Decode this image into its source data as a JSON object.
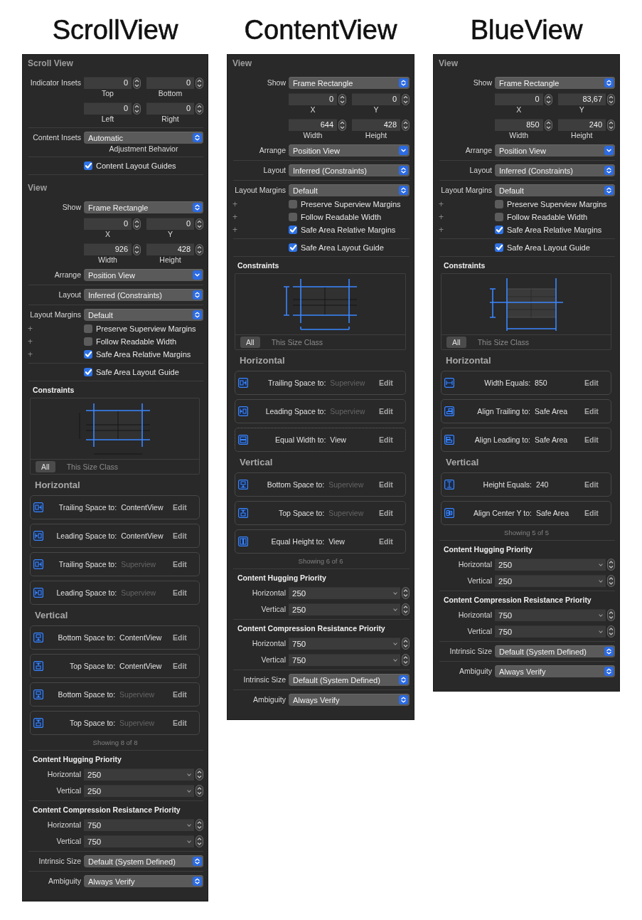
{
  "panels": [
    {
      "heading": "ScrollView",
      "groups": [
        [
          {
            "kind": "section_title",
            "text": "Scroll View"
          },
          {
            "kind": "field_pair",
            "label": "Indicator Insets",
            "fields": [
              {
                "value": "0",
                "caption": "Top"
              },
              {
                "value": "0",
                "caption": "Bottom"
              }
            ]
          },
          {
            "kind": "field_pair",
            "fields": [
              {
                "value": "0",
                "caption": "Left"
              },
              {
                "value": "0",
                "caption": "Right"
              }
            ]
          }
        ],
        [
          {
            "kind": "popup",
            "label": "Content Insets",
            "value": "Automatic",
            "caption": "Adjustment Behavior"
          }
        ],
        [
          {
            "kind": "checkbox",
            "label": "Content Layout Guides",
            "checked": true
          }
        ],
        [
          {
            "kind": "section_title",
            "text": "View"
          },
          {
            "kind": "popup",
            "label": "Show",
            "value": "Frame Rectangle"
          },
          {
            "kind": "field_pair",
            "fields": [
              {
                "value": "0",
                "caption": "X"
              },
              {
                "value": "0",
                "caption": "Y"
              }
            ]
          },
          {
            "kind": "field_pair",
            "fields": [
              {
                "value": "926",
                "caption": "Width"
              },
              {
                "value": "428",
                "caption": "Height"
              }
            ]
          },
          {
            "kind": "pulldown",
            "label": "Arrange",
            "value": "Position View"
          }
        ],
        [
          {
            "kind": "popup",
            "label": "Layout",
            "value": "Inferred (Constraints)"
          }
        ],
        [
          {
            "kind": "popup",
            "label": "Layout Margins",
            "value": "Default"
          },
          {
            "kind": "checkbox",
            "prefix": "+",
            "label": "Preserve Superview Margins",
            "checked": false
          },
          {
            "kind": "checkbox",
            "prefix": "+",
            "label": "Follow Readable Width",
            "checked": false
          },
          {
            "kind": "checkbox",
            "prefix": "+",
            "label": "Safe Area Relative Margins",
            "checked": true
          }
        ],
        [
          {
            "kind": "checkbox",
            "label": "Safe Area Layout Guide",
            "checked": true
          }
        ],
        [
          {
            "kind": "constraints",
            "title": "Constraints",
            "diagram": {
              "kind": "edges"
            },
            "tabs": [
              {
                "label": "All",
                "selected": true
              },
              {
                "label": "This Size Class",
                "selected": false
              }
            ]
          },
          {
            "kind": "constraint_list",
            "heading": "Horizontal",
            "items": [
              {
                "kind": "trailing",
                "label": "Trailing Space to:",
                "target": "ContentView",
                "dimmed": false,
                "dashed": false,
                "action": "Edit"
              },
              {
                "kind": "leading",
                "label": "Leading Space to:",
                "target": "ContentView",
                "dimmed": false,
                "dashed": false,
                "action": "Edit"
              },
              {
                "kind": "trailing",
                "label": "Trailing Space to:",
                "target": "Superview",
                "dimmed": true,
                "dashed": false,
                "action": "Edit"
              },
              {
                "kind": "leading",
                "label": "Leading Space to:",
                "target": "Superview",
                "dimmed": true,
                "dashed": false,
                "action": "Edit"
              }
            ]
          },
          {
            "kind": "constraint_list",
            "heading": "Vertical",
            "items": [
              {
                "kind": "bottom",
                "label": "Bottom Space to:",
                "target": "ContentView",
                "dimmed": false,
                "dashed": false,
                "action": "Edit"
              },
              {
                "kind": "top",
                "label": "Top Space to:",
                "target": "ContentView",
                "dimmed": false,
                "dashed": false,
                "action": "Edit"
              },
              {
                "kind": "bottom",
                "label": "Bottom Space to:",
                "target": "Superview",
                "dimmed": true,
                "dashed": false,
                "action": "Edit"
              },
              {
                "kind": "top",
                "label": "Top Space to:",
                "target": "Superview",
                "dimmed": true,
                "dashed": false,
                "action": "Edit"
              }
            ]
          },
          {
            "kind": "footnote",
            "text": "Showing 8 of 8"
          }
        ],
        [
          {
            "kind": "priority",
            "title": "Content Hugging Priority",
            "rows": [
              {
                "label": "Horizontal",
                "value": "250"
              },
              {
                "label": "Vertical",
                "value": "250"
              }
            ]
          }
        ],
        [
          {
            "kind": "priority",
            "title": "Content Compression Resistance Priority",
            "rows": [
              {
                "label": "Horizontal",
                "value": "750"
              },
              {
                "label": "Vertical",
                "value": "750"
              }
            ]
          }
        ],
        [
          {
            "kind": "popup",
            "label": "Intrinsic Size",
            "value": "Default (System Defined)"
          }
        ],
        [
          {
            "kind": "popup",
            "label": "Ambiguity",
            "value": "Always Verify"
          }
        ]
      ]
    },
    {
      "heading": "ContentView",
      "groups": [
        [
          {
            "kind": "section_title",
            "text": "View"
          },
          {
            "kind": "popup",
            "label": "Show",
            "value": "Frame Rectangle"
          },
          {
            "kind": "field_pair",
            "fields": [
              {
                "value": "0",
                "caption": "X"
              },
              {
                "value": "0",
                "caption": "Y"
              }
            ]
          },
          {
            "kind": "field_pair",
            "fields": [
              {
                "value": "644",
                "caption": "Width"
              },
              {
                "value": "428",
                "caption": "Height"
              }
            ]
          },
          {
            "kind": "pulldown",
            "label": "Arrange",
            "value": "Position View"
          }
        ],
        [
          {
            "kind": "popup",
            "label": "Layout",
            "value": "Inferred (Constraints)"
          }
        ],
        [
          {
            "kind": "popup",
            "label": "Layout Margins",
            "value": "Default"
          },
          {
            "kind": "checkbox",
            "prefix": "+",
            "label": "Preserve Superview Margins",
            "checked": false
          },
          {
            "kind": "checkbox",
            "prefix": "+",
            "label": "Follow Readable Width",
            "checked": false
          },
          {
            "kind": "checkbox",
            "prefix": "+",
            "label": "Safe Area Relative Margins",
            "checked": true
          }
        ],
        [
          {
            "kind": "checkbox",
            "label": "Safe Area Layout Guide",
            "checked": true
          }
        ],
        [
          {
            "kind": "constraints",
            "title": "Constraints",
            "diagram": {
              "kind": "edges_size"
            },
            "tabs": [
              {
                "label": "All",
                "selected": true
              },
              {
                "label": "This Size Class",
                "selected": false
              }
            ]
          },
          {
            "kind": "constraint_list",
            "heading": "Horizontal",
            "items": [
              {
                "kind": "trailing",
                "label": "Trailing Space to:",
                "target": "Superview",
                "dimmed": true,
                "dashed": false,
                "action": "Edit"
              },
              {
                "kind": "leading",
                "label": "Leading Space to:",
                "target": "Superview",
                "dimmed": true,
                "dashed": false,
                "action": "Edit"
              },
              {
                "kind": "equal_width",
                "label": "Equal Width to:",
                "target": "View",
                "dimmed": false,
                "dashed": true,
                "action": "Edit"
              }
            ]
          },
          {
            "kind": "constraint_list",
            "heading": "Vertical",
            "items": [
              {
                "kind": "bottom",
                "label": "Bottom Space to:",
                "target": "Superview",
                "dimmed": true,
                "dashed": false,
                "action": "Edit"
              },
              {
                "kind": "top",
                "label": "Top Space to:",
                "target": "Superview",
                "dimmed": true,
                "dashed": false,
                "action": "Edit"
              },
              {
                "kind": "equal_height",
                "label": "Equal Height to:",
                "target": "View",
                "dimmed": false,
                "dashed": false,
                "action": "Edit"
              }
            ]
          },
          {
            "kind": "footnote",
            "text": "Showing 6 of 6"
          }
        ],
        [
          {
            "kind": "priority",
            "title": "Content Hugging Priority",
            "rows": [
              {
                "label": "Horizontal",
                "value": "250"
              },
              {
                "label": "Vertical",
                "value": "250"
              }
            ]
          }
        ],
        [
          {
            "kind": "priority",
            "title": "Content Compression Resistance Priority",
            "rows": [
              {
                "label": "Horizontal",
                "value": "750"
              },
              {
                "label": "Vertical",
                "value": "750"
              }
            ]
          }
        ],
        [
          {
            "kind": "popup",
            "label": "Intrinsic Size",
            "value": "Default (System Defined)"
          }
        ],
        [
          {
            "kind": "popup",
            "label": "Ambiguity",
            "value": "Always Verify"
          }
        ]
      ]
    },
    {
      "heading": "BlueView",
      "groups": [
        [
          {
            "kind": "section_title",
            "text": "View"
          },
          {
            "kind": "popup",
            "label": "Show",
            "value": "Frame Rectangle"
          },
          {
            "kind": "field_pair",
            "fields": [
              {
                "value": "0",
                "caption": "X"
              },
              {
                "value": "83,67",
                "caption": "Y"
              }
            ]
          },
          {
            "kind": "field_pair",
            "fields": [
              {
                "value": "850",
                "caption": "Width"
              },
              {
                "value": "240",
                "caption": "Height"
              }
            ]
          },
          {
            "kind": "pulldown",
            "label": "Arrange",
            "value": "Position View"
          }
        ],
        [
          {
            "kind": "popup",
            "label": "Layout",
            "value": "Inferred (Constraints)"
          }
        ],
        [
          {
            "kind": "popup",
            "label": "Layout Margins",
            "value": "Default"
          },
          {
            "kind": "checkbox",
            "prefix": "+",
            "label": "Preserve Superview Margins",
            "checked": false
          },
          {
            "kind": "checkbox",
            "prefix": "+",
            "label": "Follow Readable Width",
            "checked": false
          },
          {
            "kind": "checkbox",
            "prefix": "+",
            "label": "Safe Area Relative Margins",
            "checked": true
          }
        ],
        [
          {
            "kind": "checkbox",
            "label": "Safe Area Layout Guide",
            "checked": true
          }
        ],
        [
          {
            "kind": "constraints",
            "title": "Constraints",
            "diagram": {
              "kind": "center_size"
            },
            "tabs": [
              {
                "label": "All",
                "selected": true
              },
              {
                "label": "This Size Class",
                "selected": false
              }
            ]
          },
          {
            "kind": "constraint_list",
            "heading": "Horizontal",
            "items": [
              {
                "kind": "width",
                "label": "Width Equals:",
                "target": "850",
                "dimmed": false,
                "dashed": false,
                "action": "Edit"
              },
              {
                "kind": "align_trailing",
                "label": "Align Trailing to:",
                "target": "Safe Area",
                "dimmed": false,
                "dashed": false,
                "action": "Edit"
              },
              {
                "kind": "align_leading",
                "label": "Align Leading to:",
                "target": "Safe Area",
                "dimmed": false,
                "dashed": false,
                "action": "Edit"
              }
            ]
          },
          {
            "kind": "constraint_list",
            "heading": "Vertical",
            "items": [
              {
                "kind": "height",
                "label": "Height Equals:",
                "target": "240",
                "dimmed": false,
                "dashed": false,
                "action": "Edit"
              },
              {
                "kind": "center_y",
                "label": "Align Center Y to:",
                "target": "Safe Area",
                "dimmed": false,
                "dashed": false,
                "action": "Edit"
              }
            ]
          },
          {
            "kind": "footnote",
            "text": "Showing 5 of 5"
          }
        ],
        [
          {
            "kind": "priority",
            "title": "Content Hugging Priority",
            "rows": [
              {
                "label": "Horizontal",
                "value": "250"
              },
              {
                "label": "Vertical",
                "value": "250"
              }
            ]
          }
        ],
        [
          {
            "kind": "priority",
            "title": "Content Compression Resistance Priority",
            "rows": [
              {
                "label": "Horizontal",
                "value": "750"
              },
              {
                "label": "Vertical",
                "value": "750"
              }
            ]
          }
        ],
        [
          {
            "kind": "popup",
            "label": "Intrinsic Size",
            "value": "Default (System Defined)"
          }
        ],
        [
          {
            "kind": "popup",
            "label": "Ambiguity",
            "value": "Always Verify"
          }
        ]
      ]
    }
  ]
}
